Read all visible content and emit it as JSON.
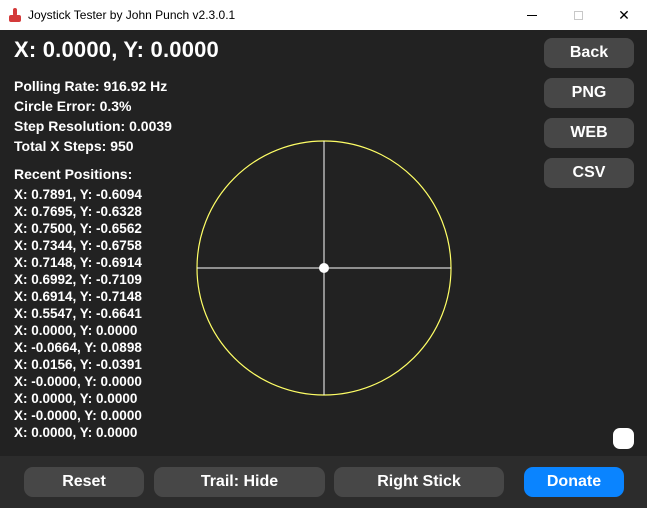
{
  "window": {
    "title": "Joystick Tester by John Punch v2.3.0.1",
    "icon": "joystick-icon",
    "controls": {
      "minimize": "minimize-icon",
      "maximize": "maximize-icon",
      "close": "✕"
    }
  },
  "readout": {
    "coords": "X: 0.0000, Y: 0.0000"
  },
  "stats": {
    "polling_rate": "Polling Rate: 916.92 Hz",
    "circle_error": "Circle Error: 0.3%",
    "step_resolution": "Step Resolution: 0.0039",
    "total_x_steps": "Total X Steps: 950"
  },
  "recent": {
    "title": "Recent Positions:",
    "items": [
      "X: 0.7891, Y: -0.6094",
      "X: 0.7695, Y: -0.6328",
      "X: 0.7500, Y: -0.6562",
      "X: 0.7344, Y: -0.6758",
      "X: 0.7148, Y: -0.6914",
      "X: 0.6992, Y: -0.7109",
      "X: 0.6914, Y: -0.7148",
      "X: 0.5547, Y: -0.6641",
      "X: 0.0000, Y: 0.0000",
      "X: -0.0664, Y: 0.0898",
      "X: 0.0156, Y: -0.0391",
      "X: -0.0000, Y: 0.0000",
      "X: 0.0000, Y: 0.0000",
      "X: -0.0000, Y: 0.0000",
      "X: 0.0000, Y: 0.0000"
    ]
  },
  "side_buttons": {
    "back": "Back",
    "png": "PNG",
    "web": "WEB",
    "csv": "CSV"
  },
  "bottom_buttons": {
    "reset": "Reset",
    "trail": "Trail: Hide",
    "stick": "Right Stick",
    "donate": "Donate"
  },
  "plot": {
    "current_position": {
      "x": 0.0,
      "y": 0.0
    },
    "circle_color": "#ffff66",
    "crosshair_color": "#ffffff"
  },
  "colors": {
    "background": "#222222",
    "button": "#474747",
    "donate": "#0a84ff"
  }
}
